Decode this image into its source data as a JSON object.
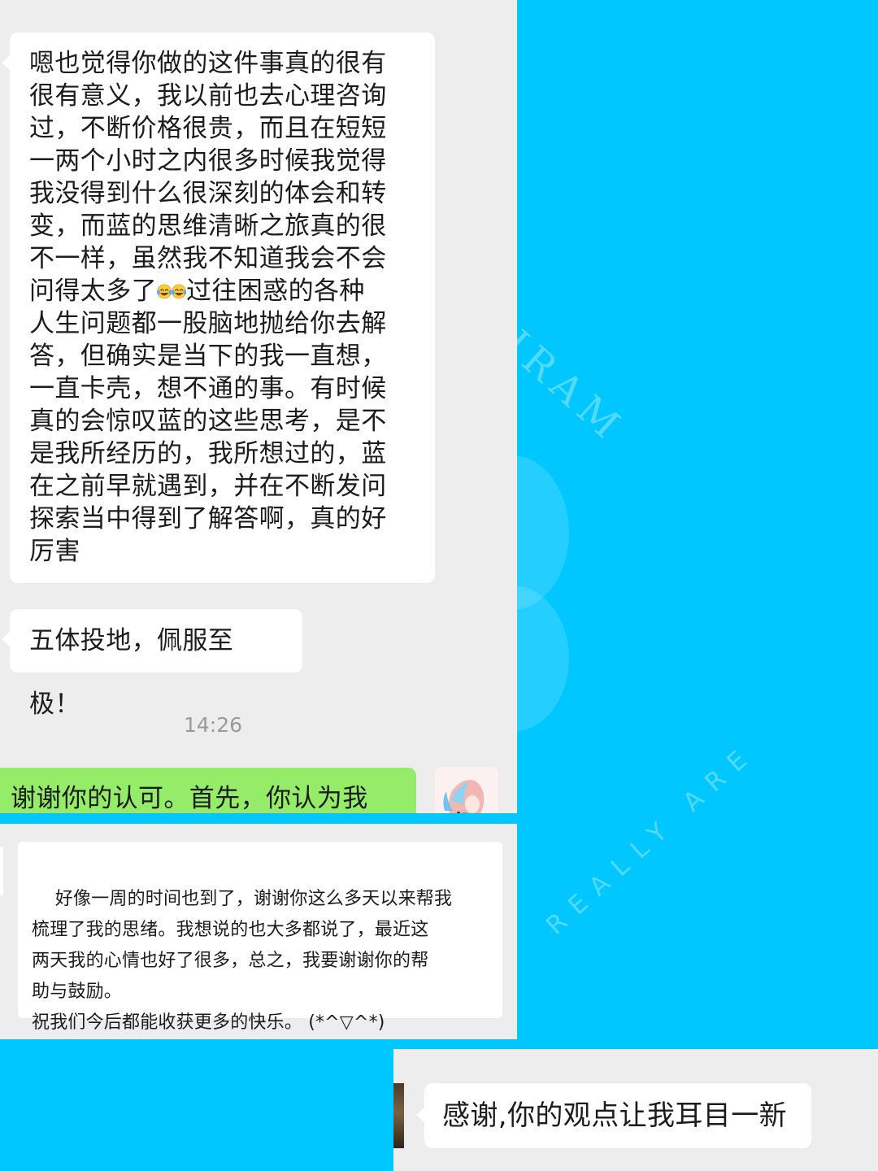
{
  "background": {
    "color": "#00c7ff",
    "watermark_top": "HRAM",
    "watermark_bottom": "REALLY ARE"
  },
  "screenshot_1": {
    "incoming_message_1_parts": [
      "嗯也觉得你做的这件事真的很有\n很有意义，我以前也去心理咨询\n过，不断价格很贵，而且在短短\n一两个小时之内很多时候我觉得\n我没得到什么很深刻的体会和转\n变，而蓝的思维清晰之旅真的很\n不一样，虽然我不知道我会不会\n问得太多了",
      "过往困惑的各种\n人生问题都一股脑地抛给你去解\n答，但确实是当下的我一直想，\n一直卡壳，想不通的事。有时候\n真的会惊叹蓝的这些思考，是不\n是我所经历的，我所想过的，蓝\n在之前早就遇到，并在不断发问\n探索当中得到了解答啊，真的好\n厉害"
    ],
    "emoji": "tears-of-joy-emoji",
    "incoming_message_2": "五体投地，佩服至极！",
    "timestamp": "14:26",
    "outgoing_message_partial": "谢谢你的认可。首先，你认为我",
    "colors": {
      "chat_background": "#ededed",
      "incoming_bubble": "#ffffff",
      "outgoing_bubble": "#95ec69"
    }
  },
  "screenshot_2": {
    "incoming_message": "好像一周的时间也到了，谢谢你这么多天以来帮我\n梳理了我的思绪。我想说的也大多都说了，最近这\n两天我的心情也好了很多，总之，我要谢谢你的帮\n助与鼓励。\n祝我们今后都能收获更多的快乐。 (*^▽^*)"
  },
  "screenshot_3": {
    "incoming_message": "感谢,你的观点让我耳目一新"
  }
}
